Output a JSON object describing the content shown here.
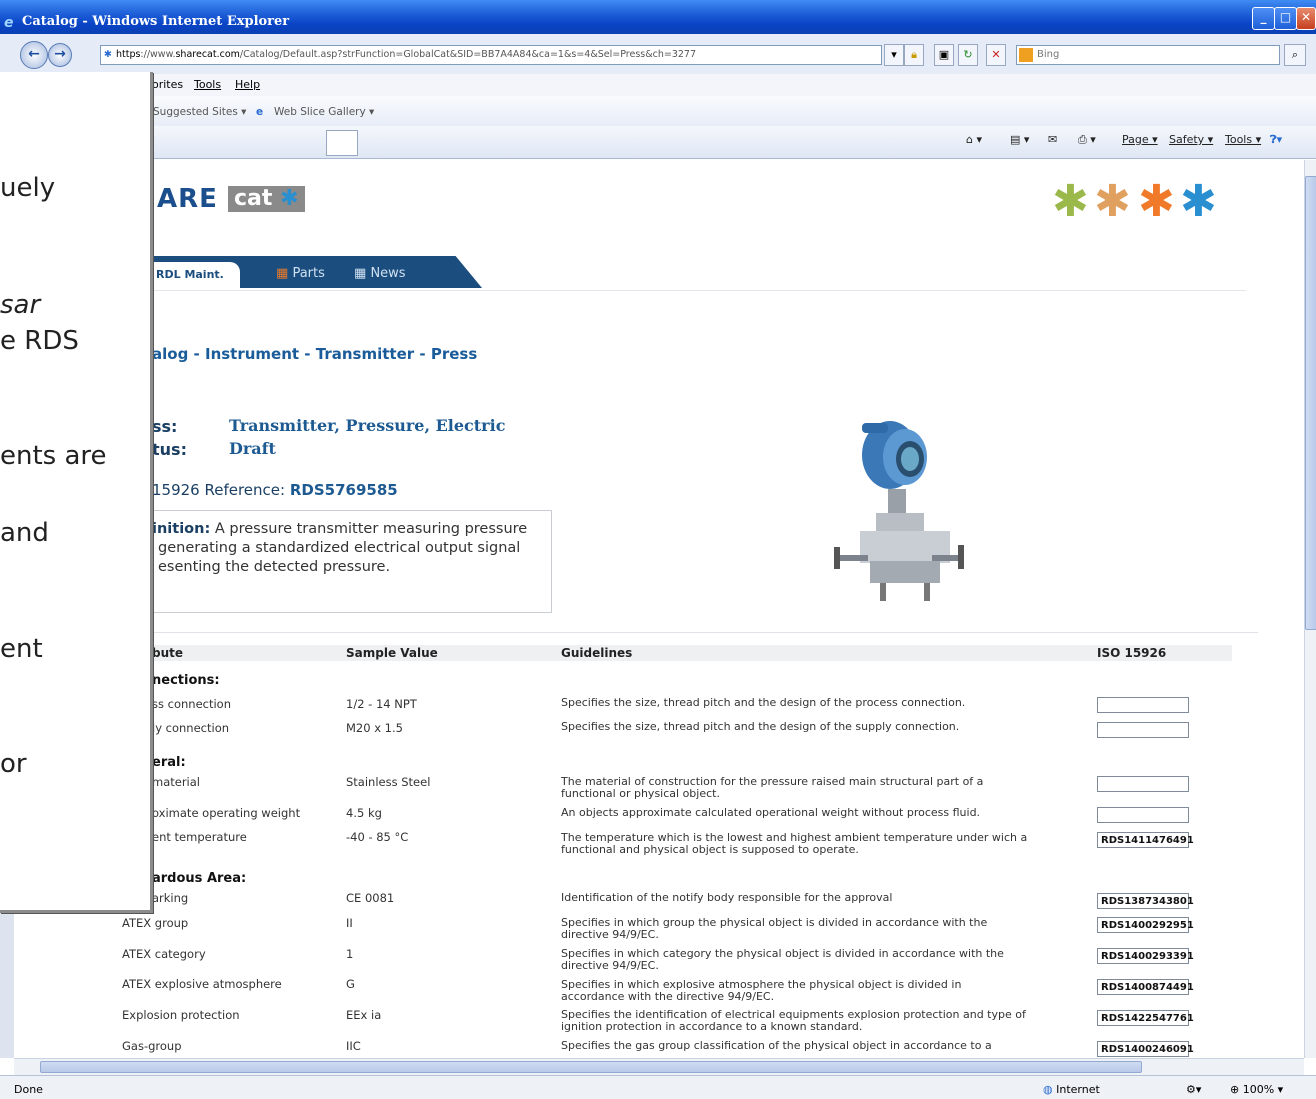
{
  "window": {
    "title": "Catalog - Windows Internet Explorer"
  },
  "address": {
    "scheme": "https",
    "url_prefix": "://www.",
    "domain": "sharecat.com",
    "path": "/Catalog/Default.asp?strFunction=GlobalCat&SID=BB7A4A84&ca=1&s=4&Sel=Press&ch=3277",
    "search_placeholder": "Bing"
  },
  "menu": {
    "favorites": "orites",
    "tools": "Tools",
    "help": "Help"
  },
  "favbar": {
    "suggested": "Suggested Sites ▾",
    "webslice": "Web Slice Gallery ▾"
  },
  "cmdbar": {
    "page": "Page ▾",
    "safety": "Safety ▾",
    "tools": "Tools ▾"
  },
  "logo": {
    "text": "ARE",
    "cat": "cat"
  },
  "nav": {
    "rdl": "RDL Maint.",
    "parts": "Parts",
    "news": "News"
  },
  "breadcrumb": {
    "catalog": "alog",
    "instrument": "Instrument",
    "transmitter": "Transmitter",
    "press": "Press",
    "sep": " - "
  },
  "product": {
    "class_label": "ss:",
    "class_value": "Transmitter, Pressure, Electric",
    "status_label": "tus:",
    "status_value": "Draft",
    "iso_ref_prefix": "15926 Reference: ",
    "iso_ref": "RDS5769585",
    "def_label": "inition:",
    "def_line1": " A pressure transmitter measuring pressure",
    "def_line2": "generating a standardized electrical output signal",
    "def_line3": "esenting the detected pressure."
  },
  "table": {
    "headers": {
      "attribute": "bute",
      "sample": "Sample Value",
      "guidelines": "Guidelines",
      "iso": "ISO 15926"
    },
    "groups": {
      "connections": "nections:",
      "general": "eral:",
      "hazard": "ardous Area:"
    },
    "rows": [
      {
        "attr": "ss connection",
        "val": "1/2 - 14 NPT",
        "guide": "Specifies the size, thread pitch and the design of the process connection.",
        "iso": ""
      },
      {
        "attr": "ly connection",
        "val": "M20 x 1.5",
        "guide": "Specifies the size, thread pitch and the design of the supply connection.",
        "iso": ""
      },
      {
        "attr": "material",
        "val": "Stainless Steel",
        "guide": "The material of construction for the pressure raised main structural part of a functional or physical object.",
        "iso": ""
      },
      {
        "attr": "oximate operating weight",
        "val": "4.5 kg",
        "guide": "An objects approximate calculated operational weight without process fluid.",
        "iso": ""
      },
      {
        "attr": "ent temperature",
        "val": "-40 - 85 °C",
        "guide": "The temperature which is the lowest and highest ambient temperature under wich a functional and physical object is supposed to operate.",
        "iso": "RDS1411476491"
      },
      {
        "attr": "arking",
        "val": "CE 0081",
        "guide": "Identification of the notify body responsible for the approval",
        "iso": "RDS1387343801"
      },
      {
        "attr": "ATEX group",
        "val": "II",
        "guide": "Specifies in which group the physical object is divided in accordance with the directive 94/9/EC.",
        "iso": "RDS1400292951"
      },
      {
        "attr": "ATEX category",
        "val": "1",
        "guide": "Specifies in which category the physical object is divided in accordance with the directive 94/9/EC.",
        "iso": "RDS1400293391"
      },
      {
        "attr": "ATEX explosive atmosphere",
        "val": "G",
        "guide": "Specifies in which explosive atmosphere the physical object is divided in accordance with the directive 94/9/EC.",
        "iso": "RDS1400874491"
      },
      {
        "attr": "Explosion protection",
        "val": "EEx ia",
        "guide": "Specifies the identification of electrical equipments explosion protection and type of ignition protection in accordance to a known standard.",
        "iso": "RDS1422547761"
      },
      {
        "attr": "Gas-group",
        "val": "IIC",
        "guide": "Specifies the gas group classification of the physical object in accordance to a",
        "iso": "RDS1400246091"
      }
    ]
  },
  "overlay": {
    "lines": [
      "uely",
      "sar",
      "e RDS",
      "ents are",
      "and",
      "ent",
      "or"
    ]
  },
  "status": {
    "left": "Done",
    "zone": "Internet",
    "zoom": "100%"
  },
  "colors": {
    "star1": "#9bb84a",
    "star2": "#e0a060",
    "star3": "#f07a2a",
    "star4": "#2a8fd0"
  }
}
